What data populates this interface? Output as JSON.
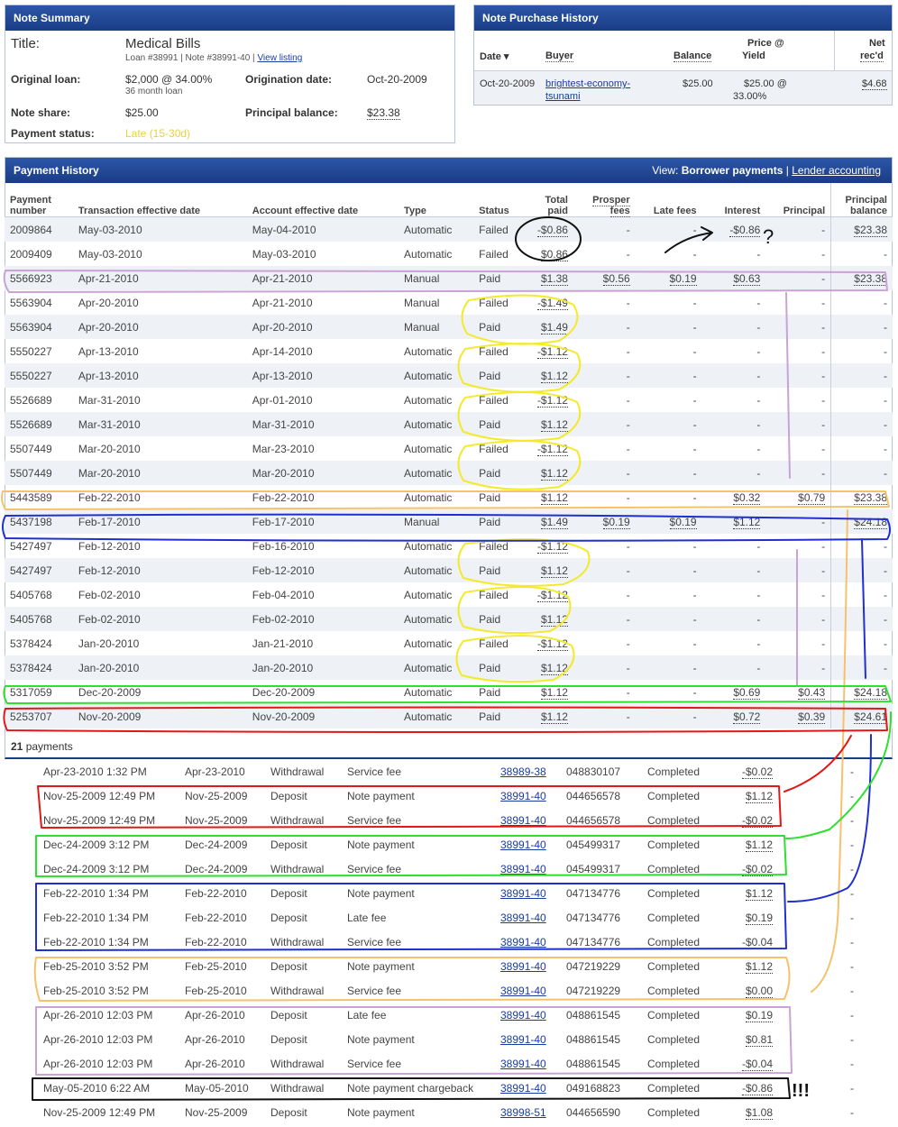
{
  "note_summary": {
    "header": "Note Summary",
    "title_label": "Title:",
    "title_value": "Medical Bills",
    "loan_info": "Loan #38991 | Note #38991-40 |",
    "view_listing": "View listing",
    "original_loan_label": "Original loan:",
    "original_loan_value": "$2,000 @ 34.00%",
    "original_loan_term": "36 month loan",
    "origination_date_label": "Origination date:",
    "origination_date_value": "Oct-20-2009",
    "note_share_label": "Note share:",
    "note_share_value": "$25.00",
    "principal_balance_label": "Principal balance:",
    "principal_balance_value": "$23.38",
    "payment_status_label": "Payment status:",
    "payment_status_value": "Late (15-30d)"
  },
  "purchase_history": {
    "header": "Note Purchase History",
    "columns": [
      "Date ▾",
      "Buyer",
      "Balance",
      "Price @",
      "Yield",
      "Net",
      "rec'd"
    ],
    "row": {
      "date": "Oct-20-2009",
      "buyer_line1": "brightest-economy-",
      "buyer_line2": "tsunami",
      "balance": "$25.00",
      "price": "$25.00 @",
      "yield": "33.00%",
      "net": "$4.68"
    }
  },
  "payment_history": {
    "header": "Payment History",
    "view_label": "View:",
    "view_current": "Borrower payments",
    "view_sep": "|",
    "view_other": "Lender accounting",
    "columns": [
      "Payment number",
      "Transaction effective date",
      "Account effective date",
      "Type",
      "Status",
      "Total paid",
      "Prosper fees",
      "Late fees",
      "Interest",
      "Principal",
      "Principal balance"
    ],
    "rows": [
      [
        "2009864",
        "May-03-2010",
        "May-04-2010",
        "Automatic",
        "Failed",
        "-$0.86",
        "-",
        "-",
        "-$0.86",
        "-",
        "$23.38"
      ],
      [
        "2009409",
        "May-03-2010",
        "May-03-2010",
        "Automatic",
        "Failed",
        "$0.86",
        "-",
        "-",
        "-",
        "-",
        "-"
      ],
      [
        "5566923",
        "Apr-21-2010",
        "Apr-21-2010",
        "Manual",
        "Paid",
        "$1.38",
        "$0.56",
        "$0.19",
        "$0.63",
        "-",
        "$23.38"
      ],
      [
        "5563904",
        "Apr-20-2010",
        "Apr-21-2010",
        "Manual",
        "Failed",
        "-$1.49",
        "-",
        "-",
        "-",
        "-",
        "-"
      ],
      [
        "5563904",
        "Apr-20-2010",
        "Apr-20-2010",
        "Manual",
        "Paid",
        "$1.49",
        "-",
        "-",
        "-",
        "-",
        "-"
      ],
      [
        "5550227",
        "Apr-13-2010",
        "Apr-14-2010",
        "Automatic",
        "Failed",
        "-$1.12",
        "-",
        "-",
        "-",
        "-",
        "-"
      ],
      [
        "5550227",
        "Apr-13-2010",
        "Apr-13-2010",
        "Automatic",
        "Paid",
        "$1.12",
        "-",
        "-",
        "-",
        "-",
        "-"
      ],
      [
        "5526689",
        "Mar-31-2010",
        "Apr-01-2010",
        "Automatic",
        "Failed",
        "-$1.12",
        "-",
        "-",
        "-",
        "-",
        "-"
      ],
      [
        "5526689",
        "Mar-31-2010",
        "Mar-31-2010",
        "Automatic",
        "Paid",
        "$1.12",
        "-",
        "-",
        "-",
        "-",
        "-"
      ],
      [
        "5507449",
        "Mar-20-2010",
        "Mar-23-2010",
        "Automatic",
        "Failed",
        "-$1.12",
        "-",
        "-",
        "-",
        "-",
        "-"
      ],
      [
        "5507449",
        "Mar-20-2010",
        "Mar-20-2010",
        "Automatic",
        "Paid",
        "$1.12",
        "-",
        "-",
        "-",
        "-",
        "-"
      ],
      [
        "5443589",
        "Feb-22-2010",
        "Feb-22-2010",
        "Automatic",
        "Paid",
        "$1.12",
        "-",
        "-",
        "$0.32",
        "$0.79",
        "$23.38"
      ],
      [
        "5437198",
        "Feb-17-2010",
        "Feb-17-2010",
        "Manual",
        "Paid",
        "$1.49",
        "$0.19",
        "$0.19",
        "$1.12",
        "-",
        "$24.18"
      ],
      [
        "5427497",
        "Feb-12-2010",
        "Feb-16-2010",
        "Automatic",
        "Failed",
        "-$1.12",
        "-",
        "-",
        "-",
        "-",
        "-"
      ],
      [
        "5427497",
        "Feb-12-2010",
        "Feb-12-2010",
        "Automatic",
        "Paid",
        "$1.12",
        "-",
        "-",
        "-",
        "-",
        "-"
      ],
      [
        "5405768",
        "Feb-02-2010",
        "Feb-04-2010",
        "Automatic",
        "Failed",
        "-$1.12",
        "-",
        "-",
        "-",
        "-",
        "-"
      ],
      [
        "5405768",
        "Feb-02-2010",
        "Feb-02-2010",
        "Automatic",
        "Paid",
        "$1.12",
        "-",
        "-",
        "-",
        "-",
        "-"
      ],
      [
        "5378424",
        "Jan-20-2010",
        "Jan-21-2010",
        "Automatic",
        "Failed",
        "-$1.12",
        "-",
        "-",
        "-",
        "-",
        "-"
      ],
      [
        "5378424",
        "Jan-20-2010",
        "Jan-20-2010",
        "Automatic",
        "Paid",
        "$1.12",
        "-",
        "-",
        "-",
        "-",
        "-"
      ],
      [
        "5317059",
        "Dec-20-2009",
        "Dec-20-2009",
        "Automatic",
        "Paid",
        "$1.12",
        "-",
        "-",
        "$0.69",
        "$0.43",
        "$24.18"
      ],
      [
        "5253707",
        "Nov-20-2009",
        "Nov-20-2009",
        "Automatic",
        "Paid",
        "$1.12",
        "-",
        "-",
        "$0.72",
        "$0.39",
        "$24.61"
      ]
    ],
    "count": "21",
    "count_label": "payments"
  },
  "transactions": [
    [
      "Apr-23-2010 1:32 PM",
      "Apr-23-2010",
      "Withdrawal",
      "Service fee",
      "38989-38",
      "048830107",
      "Completed",
      "-$0.02",
      "-"
    ],
    [
      "Nov-25-2009 12:49 PM",
      "Nov-25-2009",
      "Deposit",
      "Note payment",
      "38991-40",
      "044656578",
      "Completed",
      "$1.12",
      "-"
    ],
    [
      "Nov-25-2009 12:49 PM",
      "Nov-25-2009",
      "Withdrawal",
      "Service fee",
      "38991-40",
      "044656578",
      "Completed",
      "-$0.02",
      "-"
    ],
    [
      "Dec-24-2009 3:12 PM",
      "Dec-24-2009",
      "Deposit",
      "Note payment",
      "38991-40",
      "045499317",
      "Completed",
      "$1.12",
      "-"
    ],
    [
      "Dec-24-2009 3:12 PM",
      "Dec-24-2009",
      "Withdrawal",
      "Service fee",
      "38991-40",
      "045499317",
      "Completed",
      "-$0.02",
      "-"
    ],
    [
      "Feb-22-2010 1:34 PM",
      "Feb-22-2010",
      "Deposit",
      "Note payment",
      "38991-40",
      "047134776",
      "Completed",
      "$1.12",
      "-"
    ],
    [
      "Feb-22-2010 1:34 PM",
      "Feb-22-2010",
      "Deposit",
      "Late fee",
      "38991-40",
      "047134776",
      "Completed",
      "$0.19",
      "-"
    ],
    [
      "Feb-22-2010 1:34 PM",
      "Feb-22-2010",
      "Withdrawal",
      "Service fee",
      "38991-40",
      "047134776",
      "Completed",
      "-$0.04",
      "-"
    ],
    [
      "Feb-25-2010 3:52 PM",
      "Feb-25-2010",
      "Deposit",
      "Note payment",
      "38991-40",
      "047219229",
      "Completed",
      "$1.12",
      "-"
    ],
    [
      "Feb-25-2010 3:52 PM",
      "Feb-25-2010",
      "Withdrawal",
      "Service fee",
      "38991-40",
      "047219229",
      "Completed",
      "$0.00",
      "-"
    ],
    [
      "Apr-26-2010 12:03 PM",
      "Apr-26-2010",
      "Deposit",
      "Late fee",
      "38991-40",
      "048861545",
      "Completed",
      "$0.19",
      "-"
    ],
    [
      "Apr-26-2010 12:03 PM",
      "Apr-26-2010",
      "Deposit",
      "Note payment",
      "38991-40",
      "048861545",
      "Completed",
      "$0.81",
      "-"
    ],
    [
      "Apr-26-2010 12:03 PM",
      "Apr-26-2010",
      "Withdrawal",
      "Service fee",
      "38991-40",
      "048861545",
      "Completed",
      "-$0.04",
      "-"
    ],
    [
      "May-05-2010 6:22 AM",
      "May-05-2010",
      "Withdrawal",
      "Note payment chargeback",
      "38991-40",
      "049168823",
      "Completed",
      "-$0.86",
      "-"
    ],
    [
      "Nov-25-2009 12:49 PM",
      "Nov-25-2009",
      "Deposit",
      "Note payment",
      "38998-51",
      "044656590",
      "Completed",
      "$1.08",
      "-"
    ]
  ],
  "annotations": {
    "question_mark": "?",
    "exclaim": "!!!"
  },
  "colors": {
    "header_blue": "#1a3c85",
    "late_yellow": "#e8d23a",
    "marker_yellow": "#f2ea2a",
    "marker_purple": "#c9a3d6",
    "marker_orange": "#f5c26b",
    "marker_blue": "#1f2fd0",
    "marker_green": "#2ee02e",
    "marker_red": "#e01818",
    "marker_black": "#111111"
  }
}
